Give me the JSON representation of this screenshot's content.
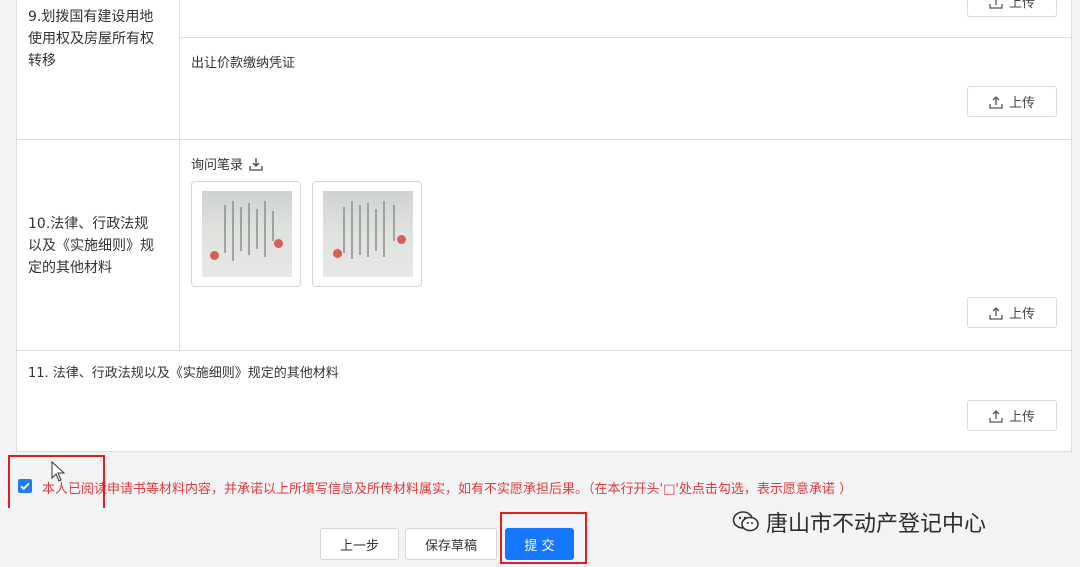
{
  "rows": [
    {
      "label": "9.划拨国有建设用地使用权及房屋所有权转移",
      "label_lines": [
        "9.划拨国有建设用地",
        "使用权及房屋所有权",
        "转移"
      ],
      "materials": [
        {
          "title": "",
          "upload_label": "上传"
        },
        {
          "title": "出让价款缴纳凭证",
          "upload_label": "上传"
        }
      ]
    },
    {
      "label_lines": [
        "10.法律、行政法规",
        "以及《实施细则》规",
        "定的其他材料"
      ],
      "materials": [
        {
          "title": "询问笔录",
          "upload_label": "上传",
          "thumbnails": 2
        }
      ]
    },
    {
      "label": "11. 法律、行政法规以及《实施细则》规定的其他材料",
      "upload_label": "上传"
    }
  ],
  "agreement": {
    "checked": true,
    "text": "本人已阅读申请书等材料内容，并承诺以上所填写信息及所传材料属实，如有不实愿承担后果。（在本行开头'□'处点击勾选，表示愿意承诺 ）"
  },
  "footer": {
    "prev_label": "上一步",
    "save_label": "保存草稿",
    "submit_label": "提 交"
  },
  "watermark": {
    "text": "唐山市不动产登记中心",
    "icon": "wechat-icon"
  },
  "colors": {
    "primary": "#1677ff",
    "warning_text": "#e23b3b",
    "highlight_box": "#e02020"
  }
}
